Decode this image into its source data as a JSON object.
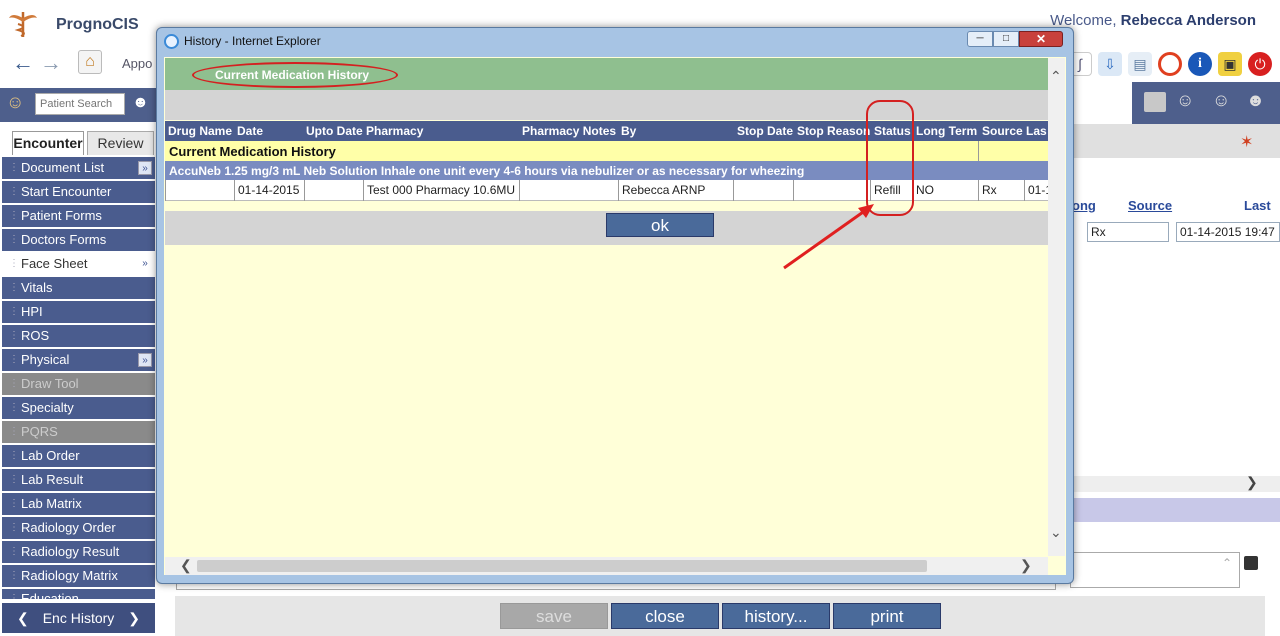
{
  "app": {
    "name": "PrognoCIS",
    "welcome_prefix": "Welcome,",
    "user_name": "Rebecca Anderson",
    "nav_label": "Appo"
  },
  "search": {
    "placeholder": "Patient Search"
  },
  "tabs": {
    "encounter": "Encounter",
    "review": "Review"
  },
  "sidebar": {
    "items": [
      {
        "label": "Document List",
        "style": "normal",
        "more": true
      },
      {
        "label": "Start Encounter",
        "style": "normal",
        "more": false
      },
      {
        "label": "Patient Forms",
        "style": "normal",
        "more": false
      },
      {
        "label": "Doctors Forms",
        "style": "normal",
        "more": false
      },
      {
        "label": "Face Sheet",
        "style": "white",
        "more": true
      },
      {
        "label": "Vitals",
        "style": "normal",
        "more": false
      },
      {
        "label": "HPI",
        "style": "normal",
        "more": false
      },
      {
        "label": "ROS",
        "style": "normal",
        "more": false
      },
      {
        "label": "Physical",
        "style": "normal",
        "more": true
      },
      {
        "label": "Draw Tool",
        "style": "gray",
        "more": false
      },
      {
        "label": "Specialty",
        "style": "normal",
        "more": false
      },
      {
        "label": "PQRS",
        "style": "gray",
        "more": false
      },
      {
        "label": "Lab Order",
        "style": "normal",
        "more": false
      },
      {
        "label": "Lab Result",
        "style": "normal",
        "more": false
      },
      {
        "label": "Lab Matrix",
        "style": "normal",
        "more": false
      },
      {
        "label": "Radiology Order",
        "style": "normal",
        "more": false
      },
      {
        "label": "Radiology Result",
        "style": "normal",
        "more": false
      },
      {
        "label": "Radiology Matrix",
        "style": "normal",
        "more": false
      },
      {
        "label": "Education",
        "style": "normal",
        "more": false
      }
    ],
    "enc_history": "Enc History"
  },
  "background": {
    "col_long": "ong",
    "col_source": "Source",
    "col_last": "Last",
    "rx_value": "Rx",
    "date_value": "01-14-2015 19:47"
  },
  "bottom_buttons": {
    "save": "save",
    "close": "close",
    "history": "history...",
    "print": "print"
  },
  "popup": {
    "window_title": "History - Internet Explorer",
    "section_title": "Current Medication History",
    "table_headers": [
      "Drug Name",
      "Date",
      "Upto Date",
      "Pharmacy",
      "Pharmacy Notes",
      "By",
      "Stop Date",
      "Stop Reason",
      "Status",
      "Long Term",
      "Source",
      "Las"
    ],
    "group_label": "Current Medication History",
    "drug_description": "AccuNeb 1.25 mg/3 mL Neb Solution Inhale one unit every 4-6 hours via nebulizer or as necessary for wheezing",
    "row": {
      "drug_name": "",
      "date": "01-14-2015",
      "upto_date": "",
      "pharmacy": "Test 000 Pharmacy 10.6MU",
      "pharmacy_notes": "",
      "by": "Rebecca ARNP",
      "stop_date": "",
      "stop_reason": "",
      "status": "Refill",
      "long_term": "NO",
      "source": "Rx",
      "last": "01-1"
    },
    "ok_label": "ok"
  },
  "colors": {
    "sidebar_blue": "#4a5c8e",
    "header_green": "#8fbf8f",
    "content_yellow": "#ffffd8",
    "annotation_red": "#d42020"
  }
}
